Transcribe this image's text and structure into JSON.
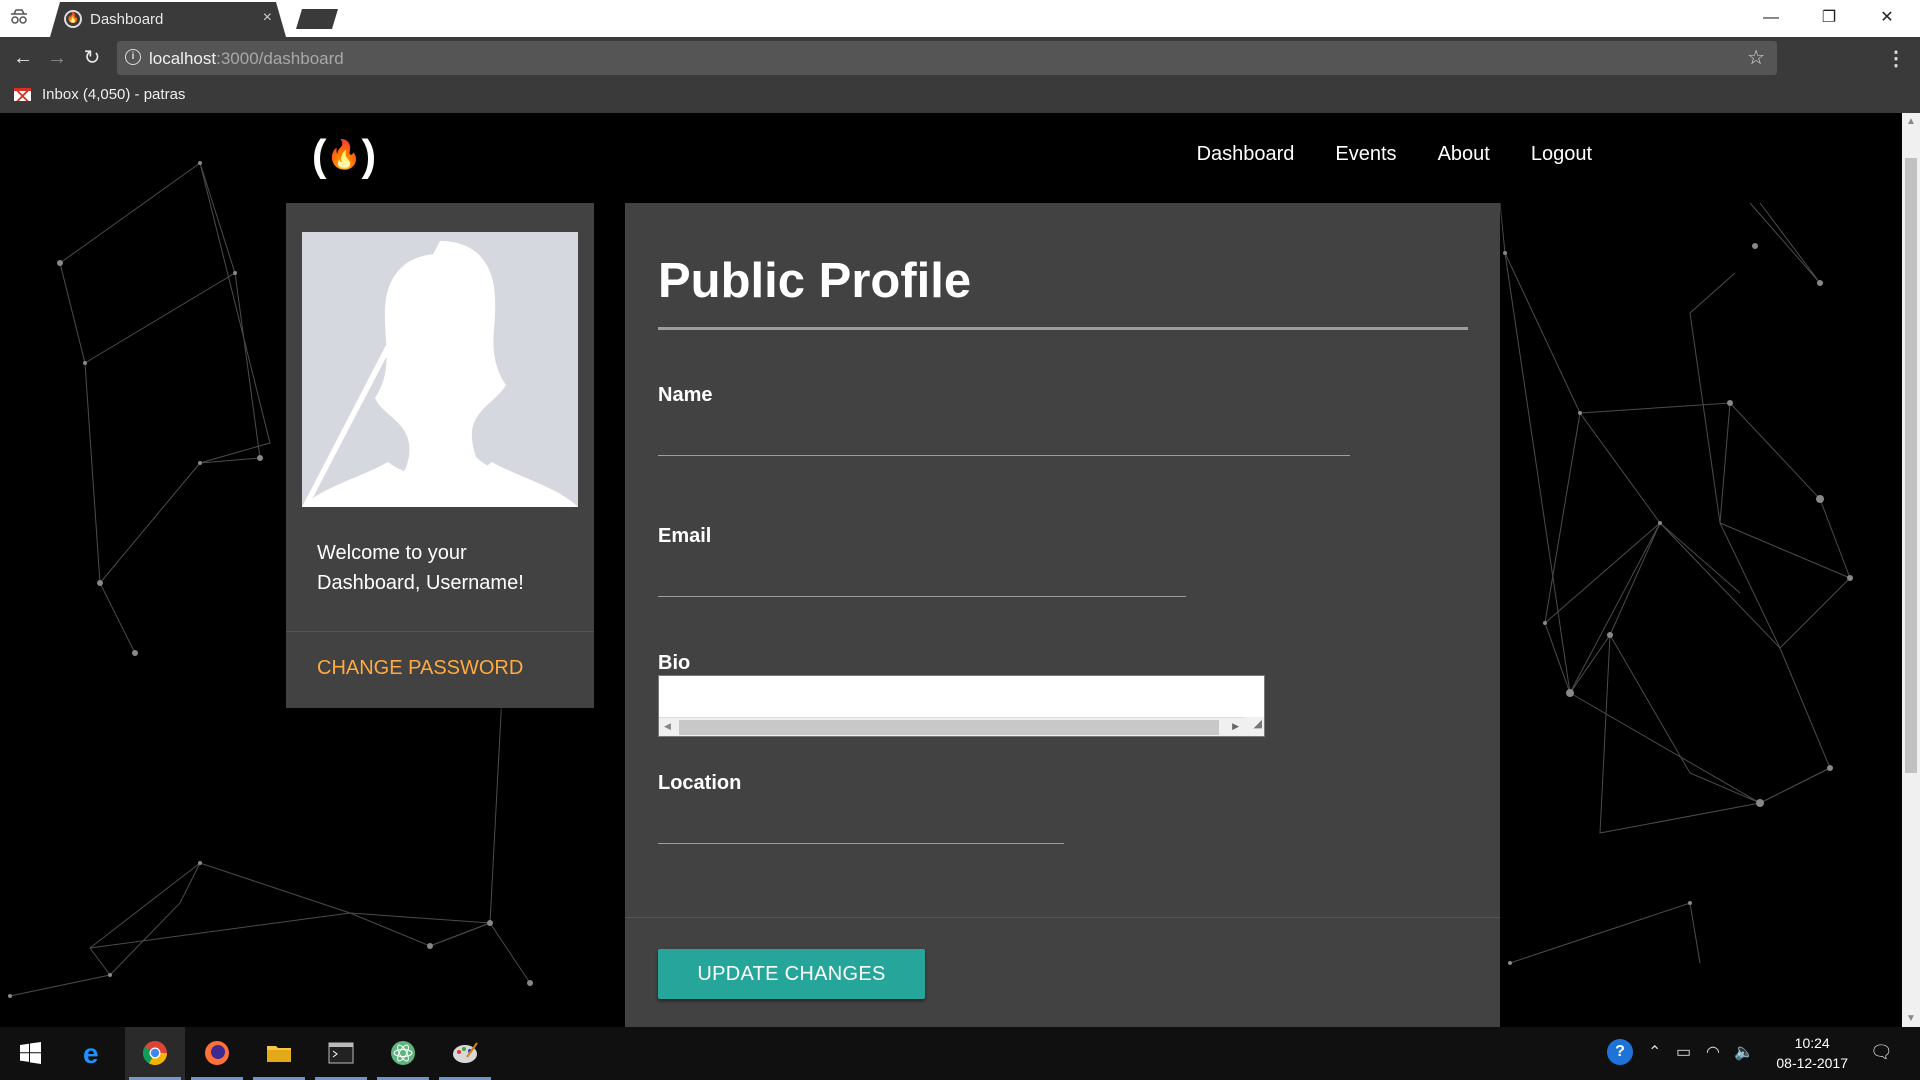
{
  "browser": {
    "tab_title": "Dashboard",
    "tab_close": "×",
    "url_host": "localhost",
    "url_path": ":3000/dashboard",
    "bookmark_label": "Inbox (4,050) - patras",
    "window_minimize": "—",
    "window_restore": "❐",
    "window_close": "✕"
  },
  "site": {
    "logo_left": "(",
    "logo_flame": "🔥",
    "logo_right": ")",
    "nav": [
      "Dashboard",
      "Events",
      "About",
      "Logout"
    ]
  },
  "sidebar": {
    "welcome": "Welcome to your Dashboard, Username!",
    "change_password": "CHANGE PASSWORD"
  },
  "profile": {
    "title": "Public Profile",
    "fields": {
      "name_label": "Name",
      "email_label": "Email",
      "bio_label": "Bio",
      "location_label": "Location"
    },
    "submit": "UPDATE CHANGES"
  },
  "taskbar": {
    "time": "10:24",
    "date": "08-12-2017"
  },
  "colors": {
    "accent_teal": "#26a69a",
    "accent_orange": "#ffab40",
    "card_bg": "#424242",
    "page_bg": "#000000"
  }
}
